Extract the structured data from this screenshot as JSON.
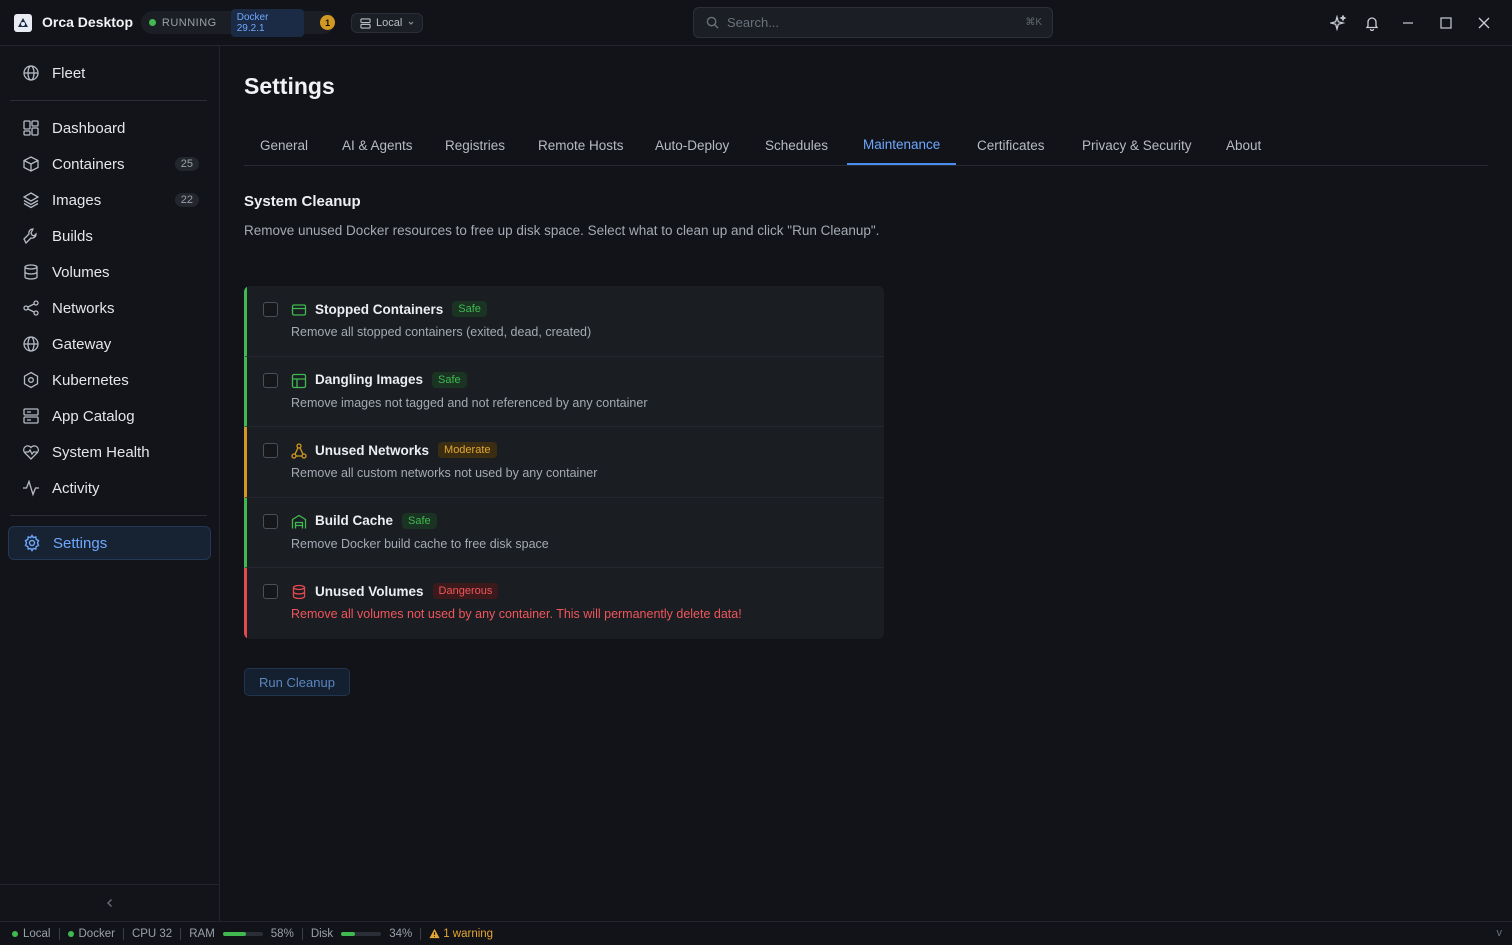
{
  "app": {
    "name": "Orca Desktop",
    "status": "RUNNING",
    "docker_version": "Docker 29.2.1",
    "warning_count": "1",
    "host": "Local"
  },
  "search": {
    "placeholder": "Search...",
    "shortcut": "⌘K"
  },
  "sidebar": {
    "items": [
      {
        "label": "Fleet",
        "icon": "globe-icon"
      },
      {
        "label": "Dashboard",
        "icon": "dashboard-icon"
      },
      {
        "label": "Containers",
        "icon": "cube-icon",
        "count": "25"
      },
      {
        "label": "Images",
        "icon": "layers-icon",
        "count": "22"
      },
      {
        "label": "Builds",
        "icon": "wrench-icon"
      },
      {
        "label": "Volumes",
        "icon": "database-icon"
      },
      {
        "label": "Networks",
        "icon": "share-icon"
      },
      {
        "label": "Gateway",
        "icon": "globe-icon"
      },
      {
        "label": "Kubernetes",
        "icon": "kubernetes-icon"
      },
      {
        "label": "App Catalog",
        "icon": "catalog-icon"
      },
      {
        "label": "System Health",
        "icon": "heart-pulse-icon"
      },
      {
        "label": "Activity",
        "icon": "activity-icon"
      },
      {
        "label": "Settings",
        "icon": "gear-icon",
        "active": true
      }
    ]
  },
  "page": {
    "title": "Settings"
  },
  "tabs": [
    "General",
    "AI & Agents",
    "Registries",
    "Remote Hosts",
    "Auto-Deploy",
    "Schedules",
    "Maintenance",
    "Certificates",
    "Privacy & Security",
    "About"
  ],
  "active_tab": "Maintenance",
  "cleanup": {
    "title": "System Cleanup",
    "description": "Remove unused Docker resources to free up disk space. Select what to clean up and click \"Run Cleanup\".",
    "items": [
      {
        "title": "Stopped Containers",
        "badge": "Safe",
        "level": "safe",
        "icon": "container-icon",
        "desc": "Remove all stopped containers (exited, dead, created)"
      },
      {
        "title": "Dangling Images",
        "badge": "Safe",
        "level": "safe",
        "icon": "image-layout-icon",
        "desc": "Remove images not tagged and not referenced by any container"
      },
      {
        "title": "Unused Networks",
        "badge": "Moderate",
        "level": "moderate",
        "icon": "network-icon",
        "desc": "Remove all custom networks not used by any container"
      },
      {
        "title": "Build Cache",
        "badge": "Safe",
        "level": "safe",
        "icon": "warehouse-icon",
        "desc": "Remove Docker build cache to free disk space"
      },
      {
        "title": "Unused Volumes",
        "badge": "Dangerous",
        "level": "danger",
        "icon": "database-icon",
        "desc": "Remove all volumes not used by any container. This will permanently delete data!"
      }
    ],
    "run_label": "Run Cleanup"
  },
  "statusbar": {
    "host": "Local",
    "engine": "Docker",
    "cpu": "CPU 32",
    "ram_label": "RAM",
    "ram_value": "58%",
    "ram_fraction": 0.58,
    "disk_label": "Disk",
    "disk_value": "34%",
    "disk_fraction": 0.34,
    "warning": "1 warning",
    "version": "v"
  },
  "colors": {
    "accent": "#6ea8fe",
    "safe": "#3fb950",
    "moderate": "#d29922",
    "danger": "#e5484d"
  }
}
